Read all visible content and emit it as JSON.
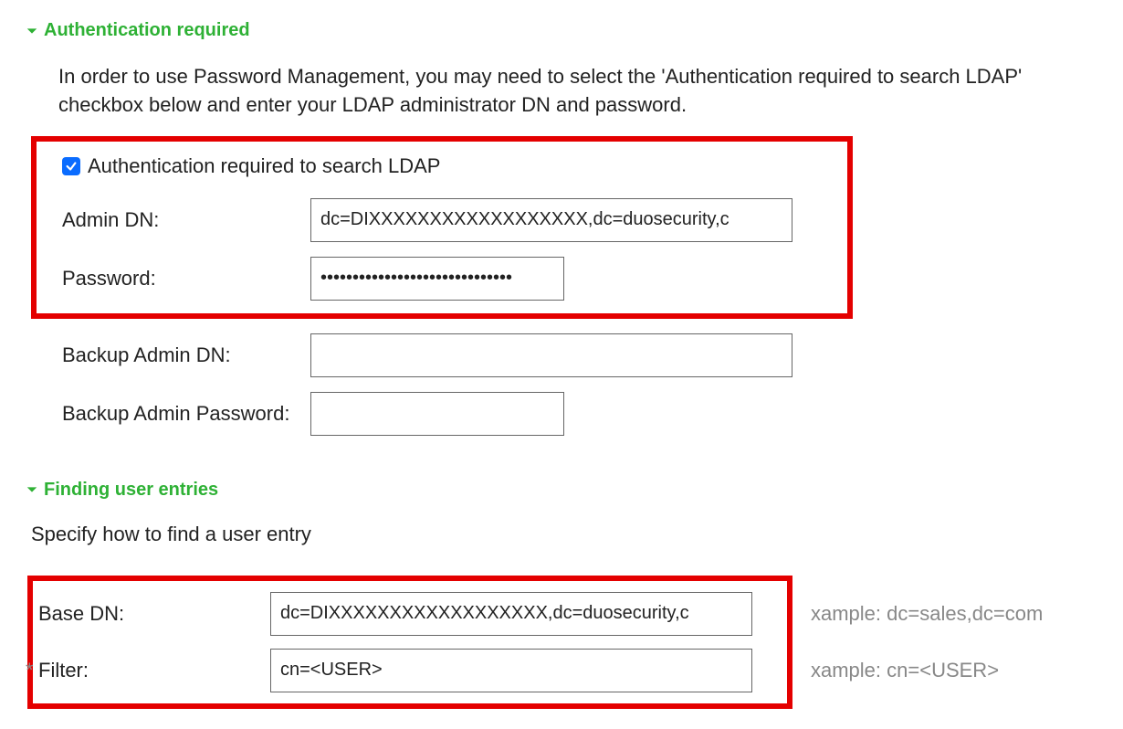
{
  "sections": {
    "auth": {
      "title": "Authentication required",
      "intro": "In order to use Password Management, you may need to select the 'Authentication required to search LDAP' checkbox below and enter your LDAP administrator DN and password.",
      "checkbox_label": "Authentication required to search LDAP",
      "fields": {
        "admin_dn_label": "Admin DN:",
        "admin_dn_value": "dc=DIXXXXXXXXXXXXXXXXXX,dc=duosecurity,c",
        "password_label": "Password:",
        "password_value": "••••••••••••••••••••••••••••••",
        "backup_admin_dn_label": "Backup Admin DN:",
        "backup_admin_dn_value": "",
        "backup_admin_password_label": "Backup Admin Password:",
        "backup_admin_password_value": ""
      }
    },
    "finding": {
      "title": "Finding user entries",
      "subhead": "Specify how to find a user entry",
      "fields": {
        "base_dn_label": "Base DN:",
        "base_dn_value": "dc=DIXXXXXXXXXXXXXXXXXX,dc=duosecurity,c",
        "base_dn_example": "xample: dc=sales,dc=com",
        "filter_label": "Filter:",
        "filter_value": "cn=<USER>",
        "filter_example": "xample: cn=<USER>"
      }
    }
  }
}
